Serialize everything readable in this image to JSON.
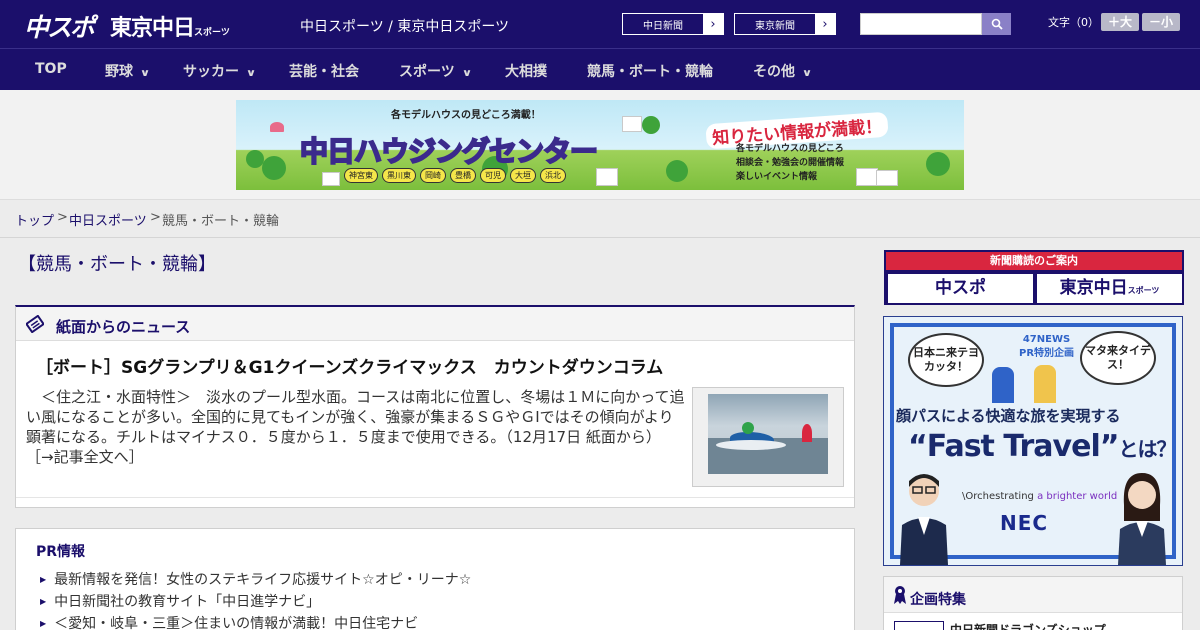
{
  "header": {
    "logo_primary": "中スポ",
    "logo_secondary": "東京中日",
    "logo_secondary_suffix": "スポーツ",
    "site_name": "中日スポーツ / 東京中日スポーツ",
    "paper_links": [
      {
        "label": "中日新聞",
        "arrow": "›"
      },
      {
        "label": "東京新聞",
        "arrow": "›"
      }
    ],
    "search_placeholder": "",
    "font_size_label": "文字（0）",
    "font_larger": "＋大",
    "font_smaller": "－小"
  },
  "nav": {
    "items": [
      {
        "label": "TOP",
        "has_menu": false
      },
      {
        "label": "野球",
        "has_menu": true
      },
      {
        "label": "サッカー",
        "has_menu": true
      },
      {
        "label": "芸能・社会",
        "has_menu": false
      },
      {
        "label": "スポーツ",
        "has_menu": true
      },
      {
        "label": "大相撲",
        "has_menu": false
      },
      {
        "label": "競馬・ボート・競輪",
        "has_menu": false
      },
      {
        "label": "その他",
        "has_menu": true
      }
    ]
  },
  "banner": {
    "tagline": "各モデルハウスの見どころ満載！",
    "title": "中日ハウジングセンター",
    "callout": "知りたい情報が満載！",
    "features": [
      "各モデルハウスの見どころ",
      "相談会・勉強会の開催情報",
      "楽しいイベント情報"
    ],
    "cities": [
      "神宮東",
      "黒川東",
      "岡崎",
      "豊橋",
      "可児",
      "大垣",
      "浜北"
    ]
  },
  "breadcrumb": {
    "items": [
      {
        "label": "トップ",
        "link": true
      },
      {
        "label": "中日スポーツ",
        "link": true
      },
      {
        "label": "競馬・ボート・競輪",
        "link": false
      }
    ],
    "separator": ">"
  },
  "page_title": "【競馬・ボート・競輪】",
  "news": {
    "section_title": "紙面からのニュース",
    "headline": "［ボート］SGグランプリ＆G1クイーンズクライマックス　カウントダウンコラム",
    "body": "　＜住之江・水面特性＞　淡水のプール型水面。コースは南北に位置し、冬場は１Ｍに向かって追い風になることが多い。全国的に見てもインが強く、強豪が集まるＳＧやＧⅠではその傾向がより顕著になる。チルトはマイナス０．５度から１．５度まで使用できる。（12月17日 紙面から）",
    "more_link": "［→記事全文へ］"
  },
  "pr": {
    "title": "PR情報",
    "items": [
      "最新情報を発信！女性のステキライフ応援サイト☆オピ・リーナ☆",
      "中日新聞社の教育サイト「中日進学ナビ」",
      "＜愛知・岐阜・三重＞住まいの情報が満載！中日住宅ナビ"
    ]
  },
  "sidebar": {
    "subscription": {
      "title": "新聞購読のご案内",
      "left": "中スポ",
      "right": "東京中日",
      "right_suffix": "スポーツ"
    },
    "ad": {
      "bubble_left": "日本ニ来テヨカッタ！",
      "bubble_right": "マタ来タイデス！",
      "pr_line1": "47NEWS",
      "pr_line2": "PR特別企画",
      "catch": "顔パスによる快適な旅を実現する",
      "big_title": "“Fast Travel”",
      "big_suffix": "とは？",
      "orchestrating_prefix": "\\Orchestrating",
      "orchestrating_suffix": "a brighter world",
      "brand": "NEC"
    },
    "feature": {
      "title": "企画特集",
      "first_item": "中日新聞ドラゴンズショップ"
    }
  },
  "colors": {
    "brand": "#1b0f6b",
    "accent_red": "#d9263f",
    "background": "#ececec"
  }
}
